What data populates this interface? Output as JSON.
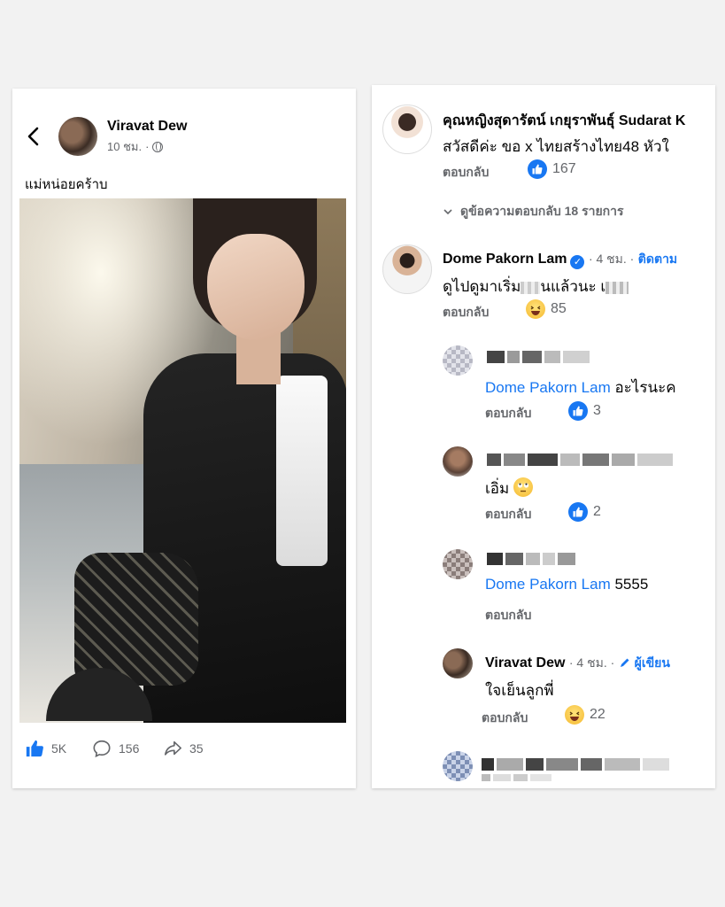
{
  "post": {
    "author": "Viravat Dew",
    "time": "10 ชม.",
    "caption": "แม่หน่อยคร้าบ",
    "likes": "5K",
    "comments": "156",
    "shares": "35"
  },
  "comments": {
    "reply_label": "ตอบกลับ",
    "c1": {
      "name": "คุณหญิงสุดารัตน์ เกยุราพันธุ์ Sudarat K",
      "text": "สวัสดีค่ะ ขอ x ไทยสร้างไทย48 หัวใ",
      "likes": "167",
      "view_replies": "ดูข้อความตอบกลับ 18 รายการ"
    },
    "c2": {
      "name": "Dome Pakorn Lam",
      "time": "· 4 ชม. ·",
      "follow": "ติดตาม",
      "text": "ดูไปดูมาเริ่ม",
      "text_end": "นแล้วนะ เ",
      "likes": "85"
    },
    "r1": {
      "mention": "Dome Pakorn Lam",
      "text": " อะไรนะค",
      "likes": "3"
    },
    "r2": {
      "text": "เอิ่ม",
      "likes": "2"
    },
    "r3": {
      "mention": "Dome Pakorn Lam",
      "text": " 5555"
    },
    "r4": {
      "name": "Viravat Dew",
      "time": "· 4 ชม. ·",
      "author_badge": "ผู้เขียน",
      "text": "ใจเย็นลูกพี่",
      "likes": "22"
    }
  },
  "colors": {
    "facebook_blue": "#1877f2",
    "secondary_text": "#65676b",
    "panel_bg": "#ffffff",
    "page_bg": "#f2f2f2"
  },
  "icons": [
    "back-arrow-icon",
    "globe-icon",
    "like-icon",
    "comment-icon",
    "share-icon",
    "verified-icon",
    "chevron-down-icon",
    "pencil-icon",
    "laugh-emoji-icon",
    "rolling-eyes-emoji-icon"
  ]
}
